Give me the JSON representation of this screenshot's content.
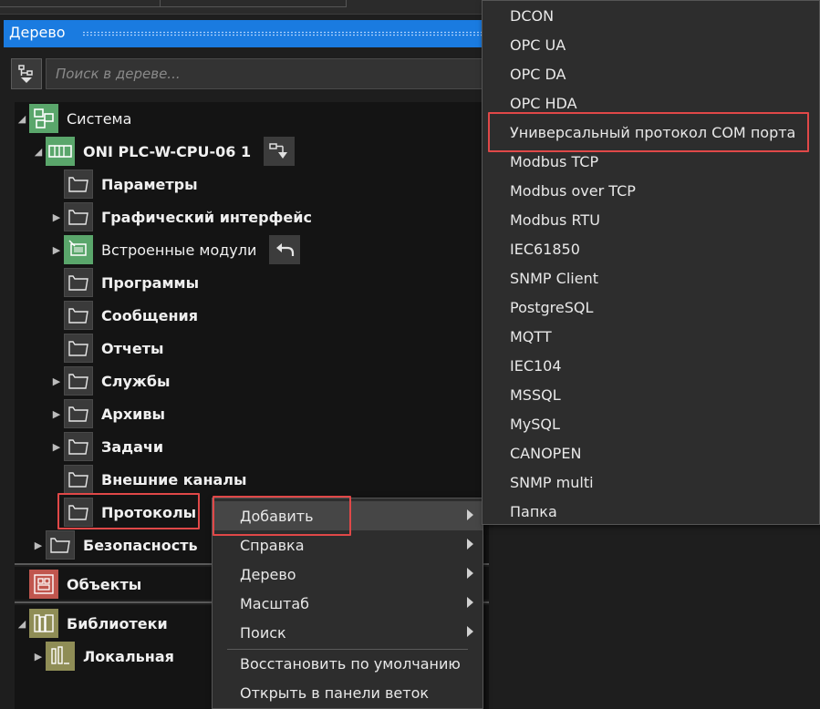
{
  "panel": {
    "title": "Дерево",
    "search_placeholder": "Поиск в дереве..."
  },
  "tree": {
    "system": "Система",
    "plc": "ONI PLC-W-CPU-06 1",
    "children": [
      "Параметры",
      "Графический интерфейс",
      "Встроенные модули",
      "Программы",
      "Сообщения",
      "Отчеты",
      "Службы",
      "Архивы",
      "Задачи",
      "Внешние каналы",
      "Протоколы"
    ],
    "security": "Безопасность",
    "objects": "Объекты",
    "libraries": "Библиотеки",
    "local": "Локальная"
  },
  "context_menu": {
    "items": [
      "Добавить",
      "Справка",
      "Дерево",
      "Масштаб",
      "Поиск"
    ],
    "actions": [
      "Восстановить по умолчанию",
      "Открыть в панели веток"
    ]
  },
  "submenu": {
    "items": [
      "DCON",
      "OPC UA",
      "OPC DA",
      "OPC HDA",
      "Универсальный протокол COM порта",
      "Modbus TCP",
      "Modbus over TCP",
      "Modbus RTU",
      "IEC61850",
      "SNMP Client",
      "PostgreSQL",
      "MQTT",
      "IEC104",
      "MSSQL",
      "MySQL",
      "CANOPEN",
      "SNMP multi",
      "Папка"
    ]
  },
  "colors": {
    "accent": "#1a7be0",
    "highlight": "#e04848"
  }
}
